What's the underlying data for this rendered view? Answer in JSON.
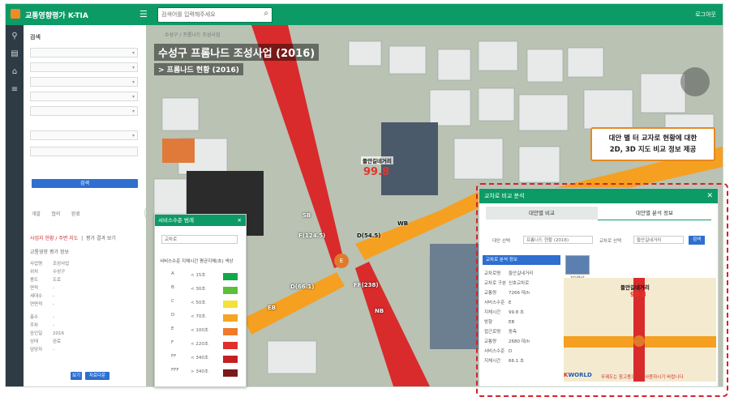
{
  "header": {
    "app_title": "교통영향평가 K-TIA",
    "search_placeholder": "검색어를 입력해주세요",
    "right_text": "로그아웃"
  },
  "left_panel": {
    "title": "검색",
    "search_button": "검색",
    "radio_labels": [
      "개발",
      "협의",
      "완료"
    ],
    "tabs": [
      "사업지 현황 / 주변 지도",
      "평가 결과 보기"
    ],
    "info_title": "교통영향 평가 정보",
    "fields": [
      {
        "k": "사업명",
        "v": "조성사업"
      },
      {
        "k": "위치",
        "v": "수성구"
      },
      {
        "k": "용도",
        "v": "도로"
      },
      {
        "k": "면적",
        "v": "-"
      },
      {
        "k": "세대수",
        "v": "-"
      },
      {
        "k": "연면적",
        "v": "-"
      },
      {
        "k": "층수",
        "v": "-"
      },
      {
        "k": "주차",
        "v": "-"
      },
      {
        "k": "승인일",
        "v": "2016"
      },
      {
        "k": "상태",
        "v": "완료"
      },
      {
        "k": "담당자",
        "v": "-"
      }
    ],
    "buttons": [
      "보기",
      "자료다운"
    ]
  },
  "map": {
    "breadcrumb": "수성구 / 프롬나드 조성사업",
    "title": "수성구 프롬나드 조성사업 (2016)",
    "subtitle": "> 프롬나드 현황 (2016)",
    "store_label": "들안길네거리",
    "store_speed": "99.8",
    "intersection_badge": "E",
    "road_labels": [
      {
        "text": "F(124.5)"
      },
      {
        "text": "D(54.5)"
      },
      {
        "text": "D(66.1)"
      },
      {
        "text": "FF(238)"
      },
      {
        "text": "SB"
      },
      {
        "text": "WB"
      },
      {
        "text": "EB"
      },
      {
        "text": "NB"
      }
    ]
  },
  "callout": {
    "line1": "대안 별 터 교자로 현황에 대한",
    "line2": "2D, 3D 지도 비교 정보 제공"
  },
  "service_popup": {
    "title": "서비스수준 범례",
    "select": "교차로",
    "headers": "서비스수준  지체시간  평균지체(초)  색상",
    "rows": [
      {
        "grade": "A",
        "range": "< 15초",
        "color": "#12a84a"
      },
      {
        "grade": "B",
        "range": "< 30초",
        "color": "#5cbf3a"
      },
      {
        "grade": "C",
        "range": "< 50초",
        "color": "#f3e23a"
      },
      {
        "grade": "D",
        "range": "< 70초",
        "color": "#f5a623"
      },
      {
        "grade": "E",
        "range": "< 100초",
        "color": "#f07a2a"
      },
      {
        "grade": "F",
        "range": "< 220초",
        "color": "#e0302c"
      },
      {
        "grade": "FF",
        "range": "< 340초",
        "color": "#c42022"
      },
      {
        "grade": "FFF",
        "range": "> 340초",
        "color": "#7a1a1a"
      }
    ]
  },
  "compare_dialog": {
    "title": "교차로 비교 분석",
    "tabs": [
      "대안별 비교",
      "대안별 분석 정보"
    ],
    "alt_label": "대안 선택",
    "alt_value": "프롬나드 현황 (2016)",
    "cross_label": "교차로 선택",
    "cross_value": "들안길네거리",
    "search_button": "검색",
    "result_title": "교차로 분석 정보",
    "thumb_label": "3D영상",
    "rows": [
      {
        "k": "교차로명",
        "v": "들안길네거리"
      },
      {
        "k": "교차로 구분",
        "v": "신호교차로"
      },
      {
        "k": "교통량",
        "v": "7266 대/h"
      },
      {
        "k": "서비스수준",
        "v": "E"
      },
      {
        "k": "지체시간",
        "v": "99.8 초"
      },
      {
        "k": "방향",
        "v": "EB"
      },
      {
        "k": "접근로명",
        "v": "동측"
      },
      {
        "k": "교통량",
        "v": "2680 대/h"
      },
      {
        "k": "서비스수준",
        "v": "D"
      },
      {
        "k": "지체시간",
        "v": "66.1 초"
      }
    ],
    "minimap_title": "들안길네거리",
    "minimap_speed": "99.8",
    "kw_logo_a": "K",
    "kw_logo_b": "WORLD",
    "notice": "무궤도는 참고용으로만 사용하시기 바랍니다"
  }
}
